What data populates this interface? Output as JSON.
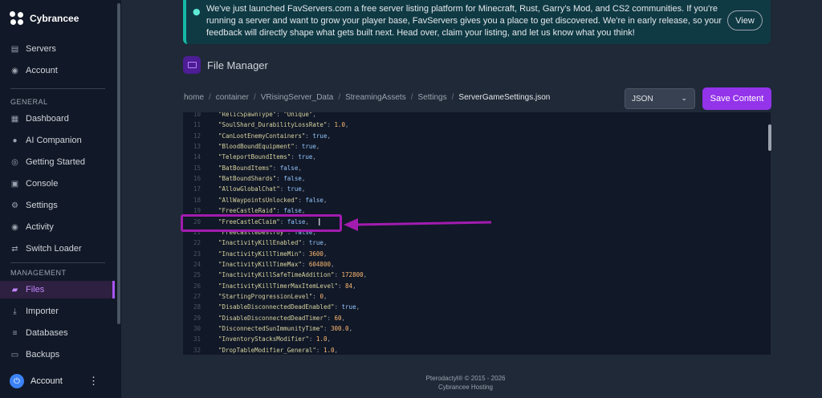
{
  "brand": {
    "name": "Cybrancee"
  },
  "sidebar": {
    "top_items": [
      {
        "label": "Servers",
        "icon": "servers-icon"
      },
      {
        "label": "Account",
        "icon": "account-icon"
      }
    ],
    "general_label": "GENERAL",
    "general_items": [
      {
        "label": "Dashboard",
        "icon": "dashboard-icon"
      },
      {
        "label": "AI Companion",
        "icon": "chat-icon"
      },
      {
        "label": "Getting Started",
        "icon": "globe-icon"
      },
      {
        "label": "Console",
        "icon": "terminal-icon"
      },
      {
        "label": "Settings",
        "icon": "gear-icon"
      },
      {
        "label": "Activity",
        "icon": "eye-icon"
      },
      {
        "label": "Switch Loader",
        "icon": "switch-icon"
      }
    ],
    "management_label": "MANAGEMENT",
    "management_items": [
      {
        "label": "Files",
        "icon": "folder-icon",
        "active": true
      },
      {
        "label": "Importer",
        "icon": "download-icon"
      },
      {
        "label": "Databases",
        "icon": "database-icon"
      },
      {
        "label": "Backups",
        "icon": "archive-icon"
      }
    ],
    "account_label": "Account"
  },
  "banner": {
    "text": "We've just launched FavServers.com a free server listing platform for Minecraft, Rust, Garry's Mod, and CS2 communities. If you're running a server and want to grow your player base, FavServers gives you a place to get discovered. We're in early release, so your feedback will directly shape what gets built next. Head over, claim your listing, and let us know what you think!",
    "button": "View"
  },
  "file_manager": {
    "title": "File Manager",
    "breadcrumb": [
      "home",
      "container",
      "VRisingServer_Data",
      "StreamingAssets",
      "Settings",
      "ServerGameSettings.json"
    ],
    "format_select": "JSON",
    "save_button": "Save Content"
  },
  "code_lines": [
    {
      "n": "10",
      "key": "\"RelicSpawnType\"",
      "val": "\"Unique\"",
      "type": "str"
    },
    {
      "n": "11",
      "key": "\"SoulShard_DurabilityLossRate\"",
      "val": "1.0",
      "type": "num"
    },
    {
      "n": "12",
      "key": "\"CanLootEnemyContainers\"",
      "val": "true",
      "type": "bool"
    },
    {
      "n": "13",
      "key": "\"BloodBoundEquipment\"",
      "val": "true",
      "type": "bool"
    },
    {
      "n": "14",
      "key": "\"TeleportBoundItems\"",
      "val": "true",
      "type": "bool"
    },
    {
      "n": "15",
      "key": "\"BatBoundItems\"",
      "val": "false",
      "type": "bool"
    },
    {
      "n": "16",
      "key": "\"BatBoundShards\"",
      "val": "false",
      "type": "bool"
    },
    {
      "n": "17",
      "key": "\"AllowGlobalChat\"",
      "val": "true",
      "type": "bool"
    },
    {
      "n": "18",
      "key": "\"AllWaypointsUnlocked\"",
      "val": "false",
      "type": "bool"
    },
    {
      "n": "19",
      "key": "\"FreeCastleRaid\"",
      "val": "false",
      "type": "bool"
    },
    {
      "n": "20",
      "key": "\"FreeCastleClaim\"",
      "val": "false",
      "type": "bool"
    },
    {
      "n": "21",
      "key": "\"FreeCastleDestroy\"",
      "val": "false",
      "type": "bool"
    },
    {
      "n": "22",
      "key": "\"InactivityKillEnabled\"",
      "val": "true",
      "type": "bool"
    },
    {
      "n": "23",
      "key": "\"InactivityKillTimeMin\"",
      "val": "3600",
      "type": "num"
    },
    {
      "n": "24",
      "key": "\"InactivityKillTimeMax\"",
      "val": "604800",
      "type": "num"
    },
    {
      "n": "25",
      "key": "\"InactivityKillSafeTimeAddition\"",
      "val": "172800",
      "type": "num"
    },
    {
      "n": "26",
      "key": "\"InactivityKillTimerMaxItemLevel\"",
      "val": "84",
      "type": "num"
    },
    {
      "n": "27",
      "key": "\"StartingProgressionLevel\"",
      "val": "0",
      "type": "num"
    },
    {
      "n": "28",
      "key": "\"DisableDisconnectedDeadEnabled\"",
      "val": "true",
      "type": "bool"
    },
    {
      "n": "29",
      "key": "\"DisableDisconnectedDeadTimer\"",
      "val": "60",
      "type": "num"
    },
    {
      "n": "30",
      "key": "\"DisconnectedSunImmunityTime\"",
      "val": "300.0",
      "type": "num"
    },
    {
      "n": "31",
      "key": "\"InventoryStacksModifier\"",
      "val": "1.0",
      "type": "num"
    },
    {
      "n": "32",
      "key": "\"DropTableModifier_General\"",
      "val": "1.0",
      "type": "num"
    }
  ],
  "footer": {
    "line1": "Pterodactyl® © 2015 - 2026",
    "line2": "Cybrancee Hosting"
  },
  "colors": {
    "accent": "#9333ea",
    "annotation": "#a21caf",
    "banner_border": "#14b8a6"
  }
}
